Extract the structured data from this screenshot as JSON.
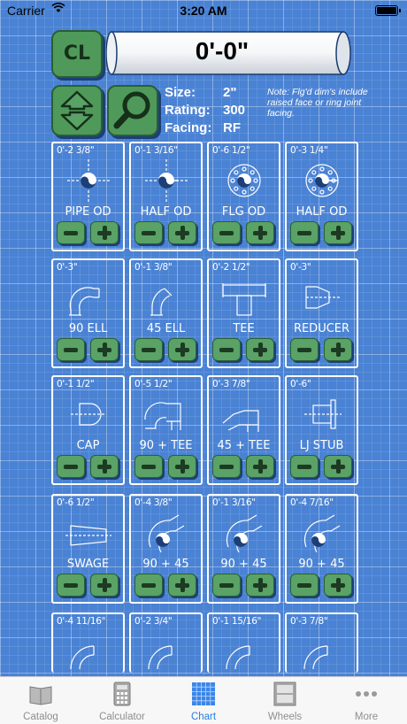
{
  "status_bar": {
    "carrier": "Carrier",
    "time": "3:20 AM"
  },
  "header": {
    "cl_label": "CL",
    "display_value": "0'-0\""
  },
  "specs": {
    "size_label": "Size:",
    "size_value": "2\"",
    "rating_label": "Rating:",
    "rating_value": "300",
    "facing_label": "Facing:",
    "facing_value": "RF"
  },
  "note": "Note: Flg'd dim's include raised face or ring joint facing.",
  "fittings": [
    {
      "dim": "0'-2 3/8\"",
      "name": "PIPE OD",
      "icon": "pipe-od-icon"
    },
    {
      "dim": "0'-1 3/16\"",
      "name": "HALF OD",
      "icon": "half-od-icon"
    },
    {
      "dim": "0'-6 1/2\"",
      "name": "FLG OD",
      "icon": "flange-od-icon"
    },
    {
      "dim": "0'-3 1/4\"",
      "name": "HALF OD",
      "icon": "flange-half-od-icon"
    },
    {
      "dim": "0'-3\"",
      "name": "90 ELL",
      "icon": "elbow-90-icon"
    },
    {
      "dim": "0'-1 3/8\"",
      "name": "45 ELL",
      "icon": "elbow-45-icon"
    },
    {
      "dim": "0'-2 1/2\"",
      "name": "TEE",
      "icon": "tee-icon"
    },
    {
      "dim": "0'-3\"",
      "name": "REDUCER",
      "icon": "reducer-icon"
    },
    {
      "dim": "0'-1 1/2\"",
      "name": "CAP",
      "icon": "cap-icon"
    },
    {
      "dim": "0'-5 1/2\"",
      "name": "90 + TEE",
      "icon": "elbow-90-tee-icon"
    },
    {
      "dim": "0'-3 7/8\"",
      "name": "45 + TEE",
      "icon": "elbow-45-tee-icon"
    },
    {
      "dim": "0'-6\"",
      "name": "LJ STUB",
      "icon": "lap-joint-stub-icon"
    },
    {
      "dim": "0'-6 1/2\"",
      "name": "SWAGE",
      "icon": "swage-icon"
    },
    {
      "dim": "0'-4 3/8\"",
      "name": "90 + 45",
      "icon": "elbow-90-45-icon"
    },
    {
      "dim": "0'-1 3/16\"",
      "name": "90 + 45",
      "icon": "elbow-90-45-icon"
    },
    {
      "dim": "0'-4 7/16\"",
      "name": "90 + 45",
      "icon": "elbow-90-45-icon"
    },
    {
      "dim": "0'-4 11/16\"",
      "name": "",
      "icon": "elbow-icon"
    },
    {
      "dim": "0'-2 3/4\"",
      "name": "",
      "icon": "elbow-icon"
    },
    {
      "dim": "0'-1 15/16\"",
      "name": "",
      "icon": "elbow-icon"
    },
    {
      "dim": "0'-3 7/8\"",
      "name": "",
      "icon": "elbow-icon"
    }
  ],
  "tabs": [
    {
      "label": "Catalog",
      "icon": "book-icon"
    },
    {
      "label": "Calculator",
      "icon": "calculator-icon"
    },
    {
      "label": "Chart",
      "icon": "grid-chart-icon"
    },
    {
      "label": "Wheels",
      "icon": "wheels-icon"
    },
    {
      "label": "More",
      "icon": "more-dots-icon"
    }
  ],
  "colors": {
    "background": "#4a82d4",
    "button_green": "#4f9a5a",
    "active_tab": "#2a7de0"
  }
}
